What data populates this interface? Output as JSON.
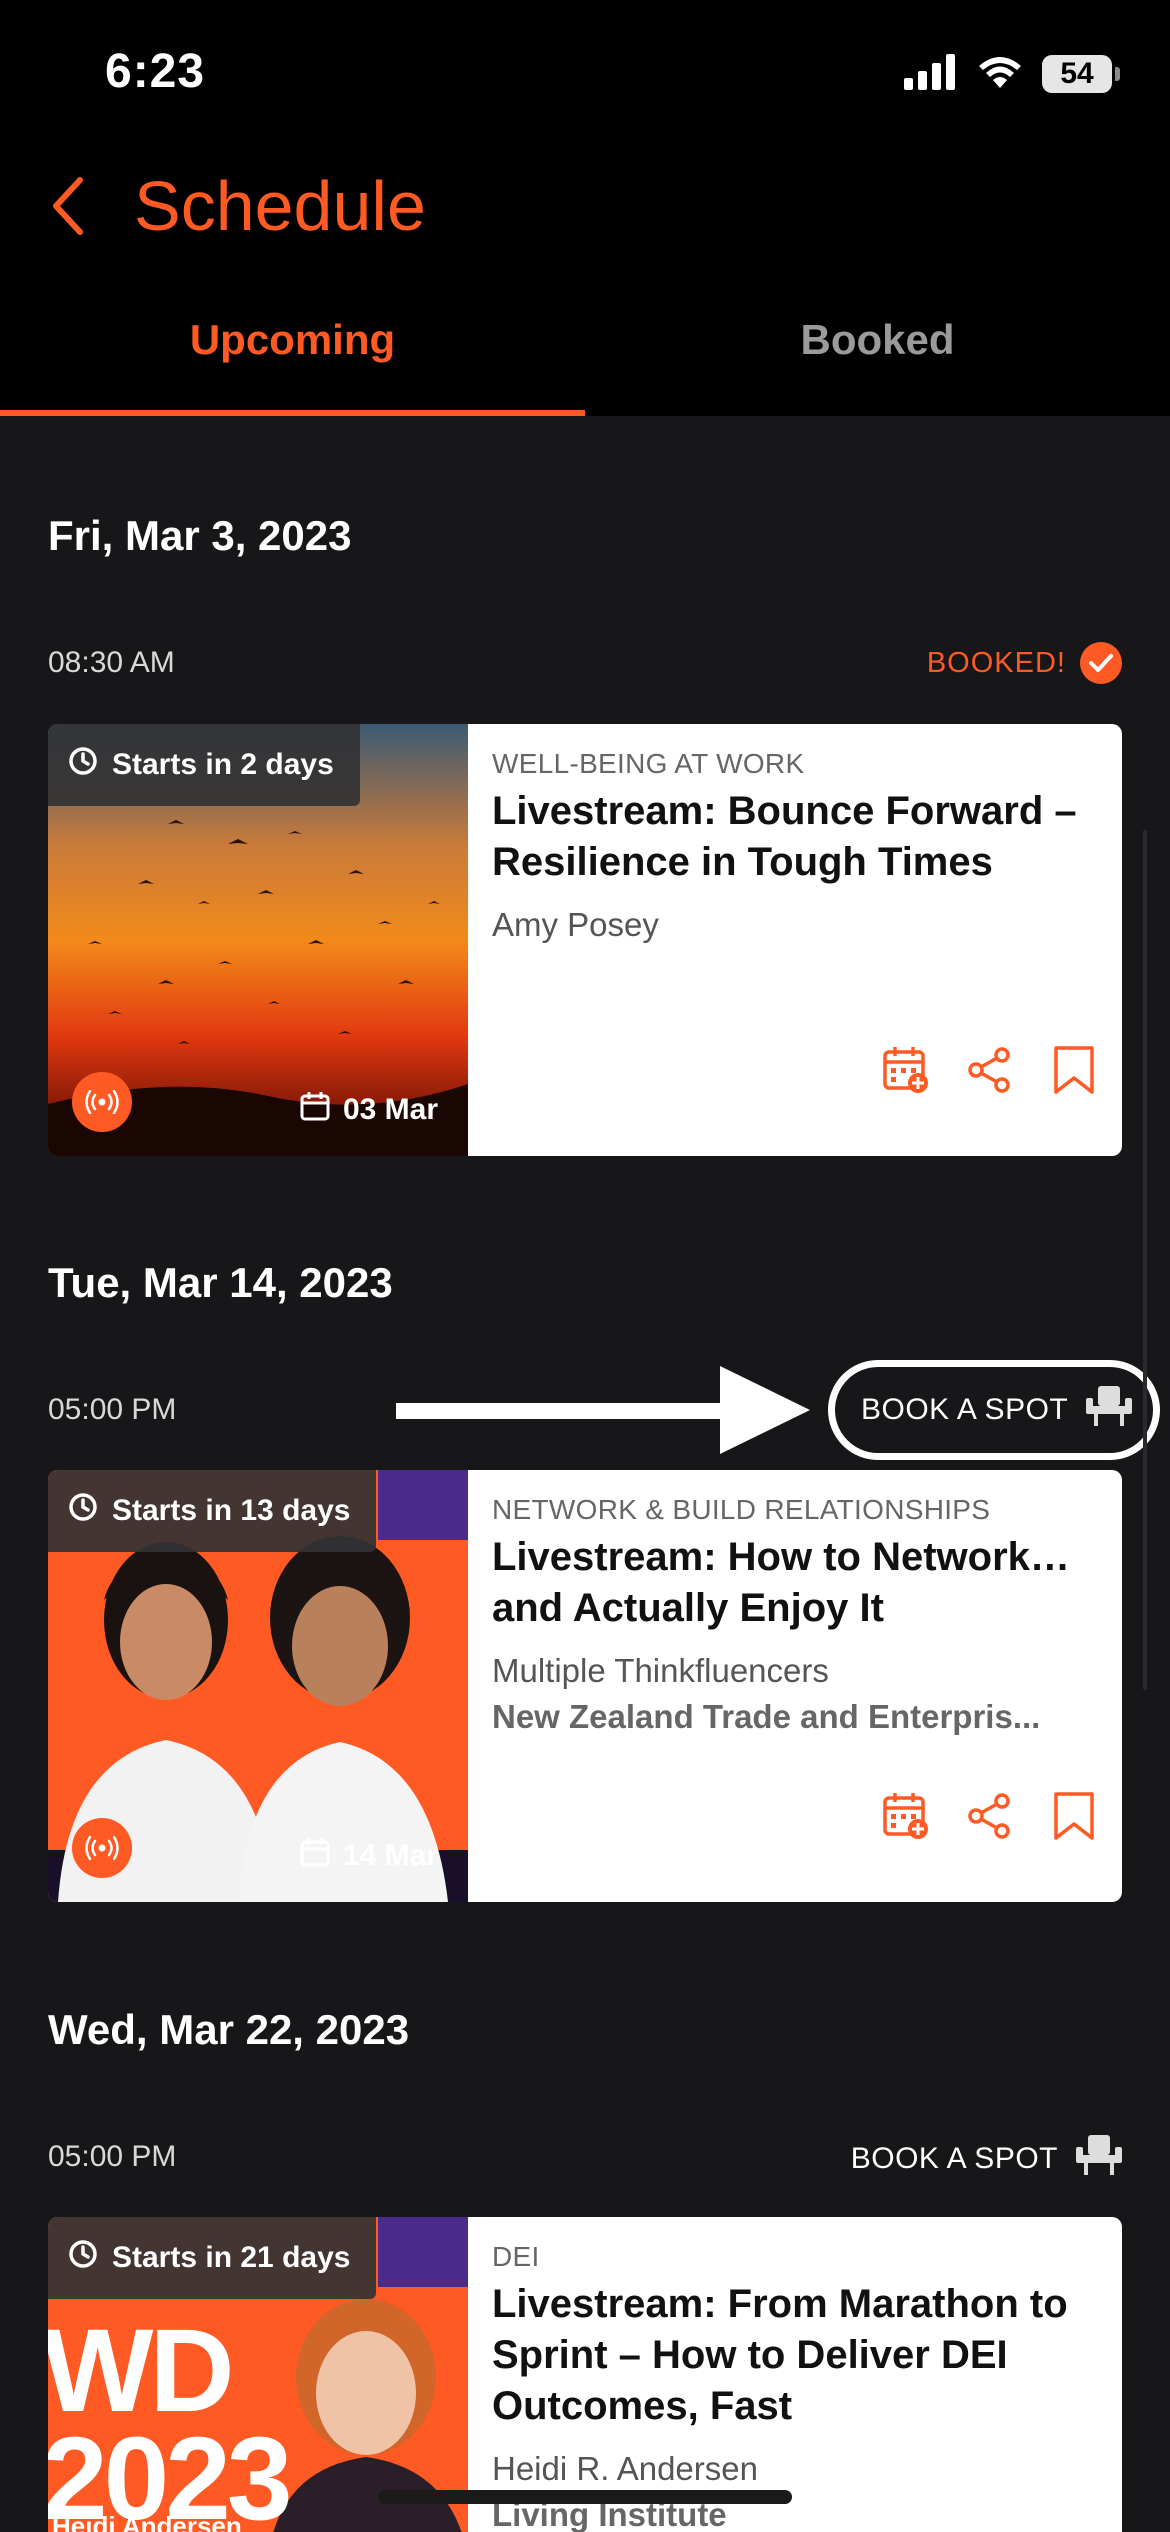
{
  "status_bar": {
    "time": "6:23",
    "battery": "54"
  },
  "header": {
    "title": "Schedule"
  },
  "tabs": [
    {
      "label": "Upcoming",
      "active": true
    },
    {
      "label": "Booked",
      "active": false
    }
  ],
  "sections": [
    {
      "date": "Fri, Mar 3, 2023",
      "time": "08:30 AM",
      "status": "BOOKED!",
      "card": {
        "starts": "Starts in 2 days",
        "date_chip": "03 Mar",
        "category": "WELL-BEING AT WORK",
        "title": "Livestream: Bounce Forward – Resilience in Tough Times",
        "author": "Amy Posey"
      }
    },
    {
      "date": "Tue, Mar 14, 2023",
      "time": "05:00 PM",
      "status": "BOOK A SPOT",
      "card": {
        "starts": "Starts in 13 days",
        "date_chip": "14 Mar",
        "category": "NETWORK & BUILD RELATIONSHIPS",
        "title": "Livestream: How to Network… and Actually Enjoy It",
        "author": "Multiple Thinkfluencers",
        "org": "New Zealand Trade and Enterpris..."
      }
    },
    {
      "date": "Wed, Mar 22, 2023",
      "time": "05:00 PM",
      "status": "BOOK A SPOT",
      "card": {
        "starts": "Starts in 21 days",
        "category": "DEI",
        "title": "Livestream: From Marathon to Sprint – How to Deliver DEI Outcomes, Fast",
        "author": "Heidi R. Andersen",
        "org": "Living Institute",
        "image_text": "WD 2023",
        "image_caption": "Heidi Andersen"
      }
    }
  ],
  "colors": {
    "accent": "#ff5a23",
    "background": "#17171a",
    "card": "#ffffff"
  }
}
